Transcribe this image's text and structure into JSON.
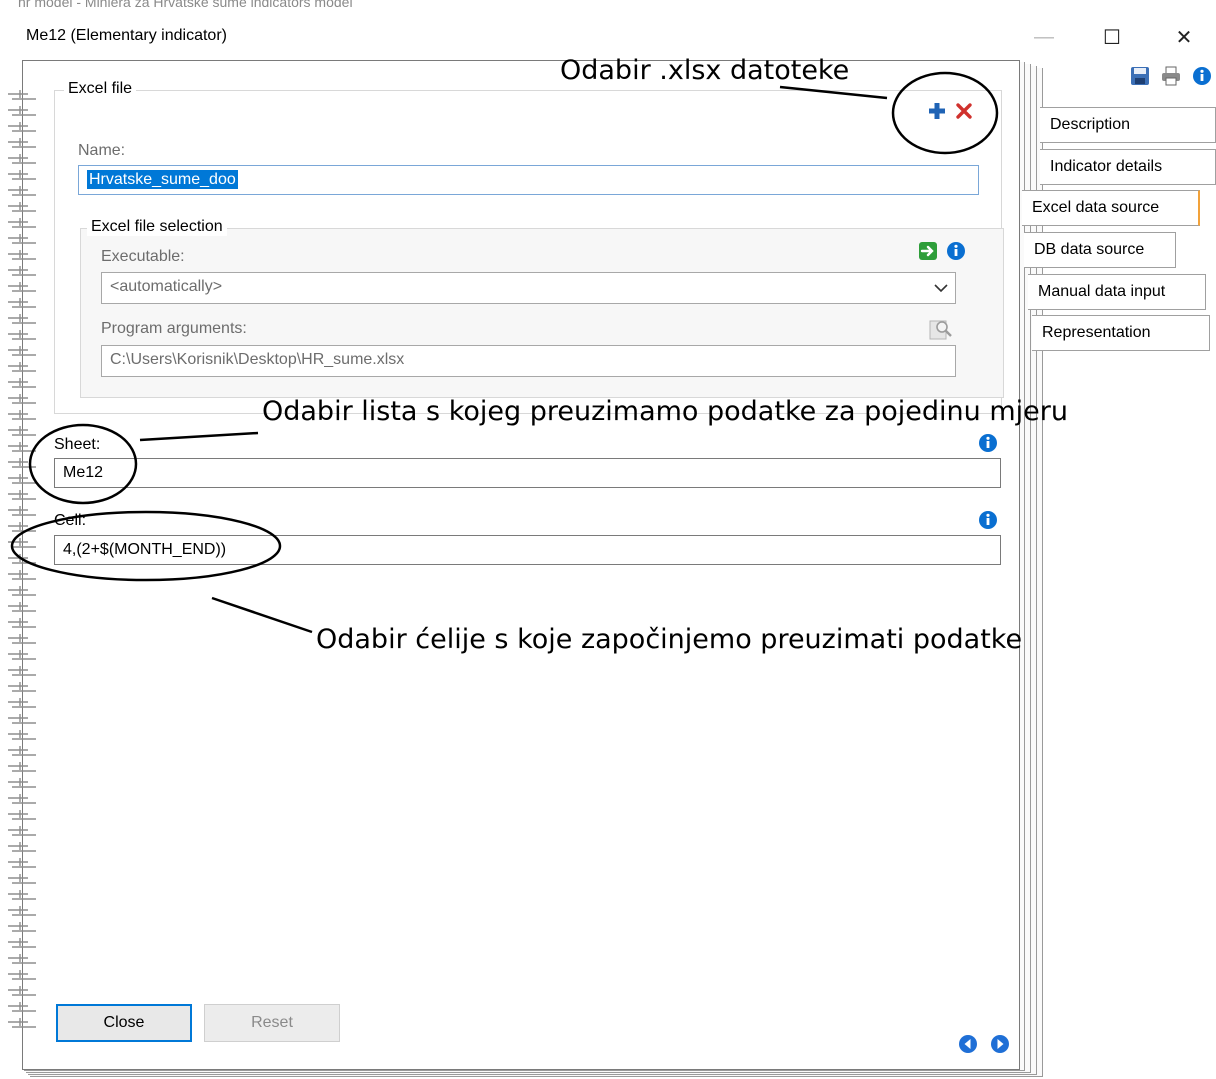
{
  "window": {
    "background_title": "hr model - Miniera za Hrvatske sume indicators model",
    "title": "Me12 (Elementary indicator)",
    "controls": {
      "minimize": "—",
      "maximize": "☐",
      "close": "✕"
    }
  },
  "toolbar": {
    "icons": [
      "save-icon",
      "print-icon",
      "info-icon"
    ]
  },
  "excel_file": {
    "legend": "Excel file",
    "add_icon": "plus-icon",
    "remove_icon": "delete-icon",
    "name_label": "Name:",
    "name_value": "Hrvatske_sume_doo"
  },
  "excel_selection": {
    "legend": "Excel file selection",
    "executable_label": "Executable:",
    "executable_value": "<automatically>",
    "arguments_label": "Program arguments:",
    "arguments_value": "C:\\Users\\Korisnik\\Desktop\\HR_sume.xlsx"
  },
  "sheet": {
    "label": "Sheet:",
    "value": "Me12"
  },
  "cell": {
    "label": "Cell:",
    "value": "4,(2+$(MONTH_END))"
  },
  "buttons": {
    "close": "Close",
    "reset": "Reset"
  },
  "tabs": [
    {
      "label": "Description",
      "active": false
    },
    {
      "label": "Indicator details",
      "active": false
    },
    {
      "label": "Excel data source",
      "active": true
    },
    {
      "label": "DB data source",
      "active": false
    },
    {
      "label": "Manual data input",
      "active": false
    },
    {
      "label": "Representation",
      "active": false
    }
  ],
  "annotations": {
    "file": "Odabir .xlsx datoteke",
    "sheet": "Odabir lista s kojeg preuzimamo podatke za pojedinu mjeru",
    "cell": "Odabir ćelije s koje započinjemo preuzimati podatke"
  },
  "colors": {
    "accent": "#0078d7",
    "active_tab_border": "#f2a23a",
    "info_blue": "#0a6fd1",
    "delete_red": "#d0312d",
    "add_blue": "#1f63b5",
    "go_green": "#2e9e3a"
  }
}
